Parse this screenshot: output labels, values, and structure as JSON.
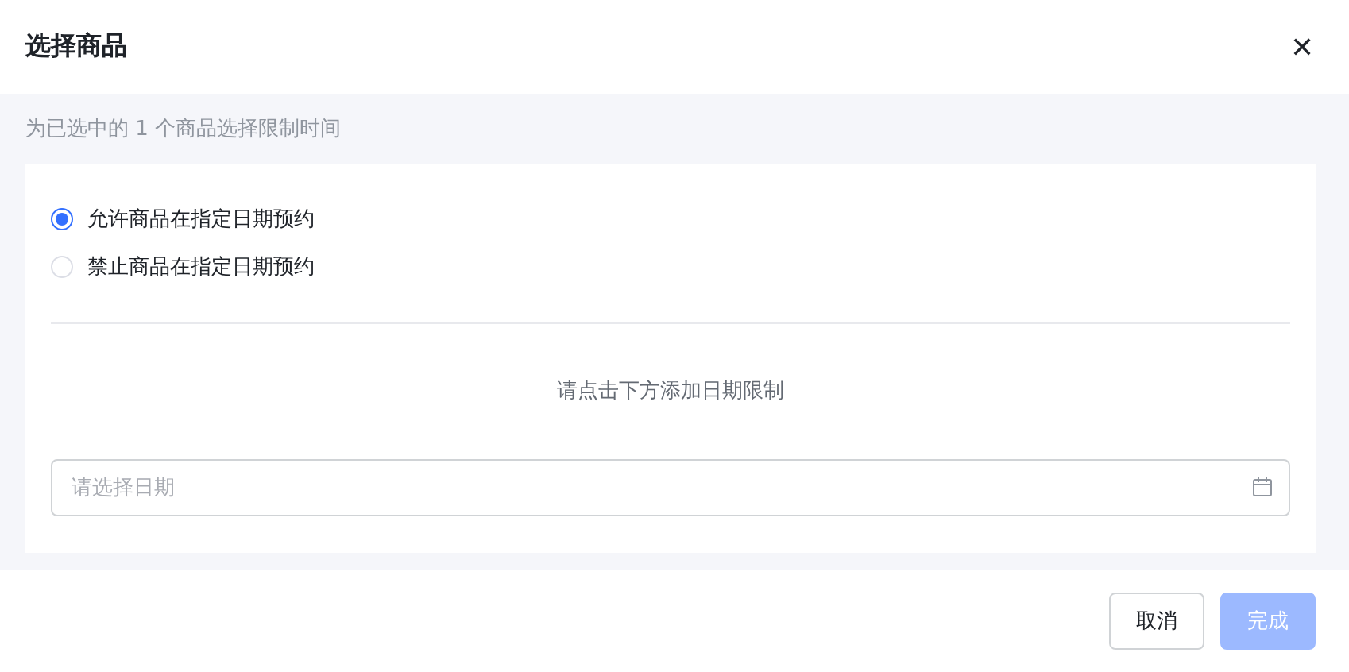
{
  "dialog": {
    "title": "选择商品",
    "close_icon": "✕"
  },
  "subtitle": "为已选中的 1 个商品选择限制时间",
  "options": [
    {
      "label": "允许商品在指定日期预约",
      "selected": true
    },
    {
      "label": "禁止商品在指定日期预约",
      "selected": false
    }
  ],
  "hint": "请点击下方添加日期限制",
  "date_field": {
    "placeholder": "请选择日期"
  },
  "buttons": [
    {
      "label": "取消",
      "kind": "secondary",
      "disabled": false
    },
    {
      "label": "完成",
      "kind": "primary",
      "disabled": true
    }
  ]
}
